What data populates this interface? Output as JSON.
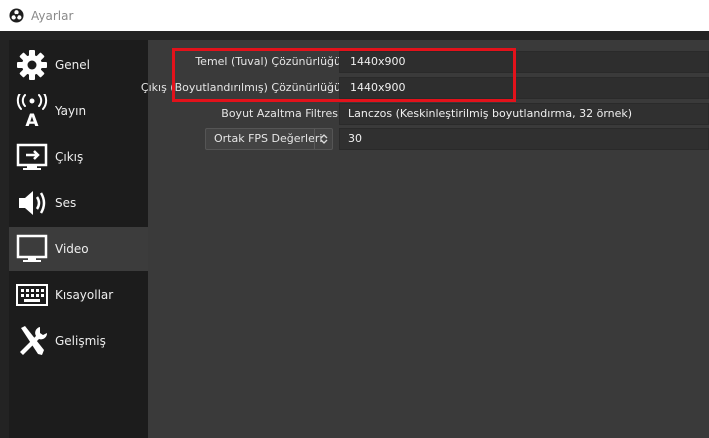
{
  "window": {
    "title": "Ayarlar"
  },
  "sidebar": {
    "items": [
      {
        "label": "Genel",
        "icon": "gear-icon",
        "active": false
      },
      {
        "label": "Yayın",
        "icon": "broadcast-icon",
        "active": false
      },
      {
        "label": "Çıkış",
        "icon": "output-icon",
        "active": false
      },
      {
        "label": "Ses",
        "icon": "speaker-icon",
        "active": false
      },
      {
        "label": "Video",
        "icon": "monitor-icon",
        "active": true
      },
      {
        "label": "Kısayollar",
        "icon": "keyboard-icon",
        "active": false
      },
      {
        "label": "Gelişmiş",
        "icon": "tools-icon",
        "active": false
      }
    ]
  },
  "video": {
    "base_resolution": {
      "label": "Temel (Tuval) Çözünürlüğü",
      "value": "1440x900"
    },
    "output_resolution": {
      "label": "Çıkış (Boyutlandırılmış) Çözünürlüğü",
      "value": "1440x900"
    },
    "downscale_filter": {
      "label": "Boyut Azaltma Filtresi",
      "value": "Lanczos (Keskinleştirilmiş boyutlandırma, 32 örnek)"
    },
    "fps": {
      "label": "Ortak FPS Değerleri",
      "value": "30"
    }
  },
  "colors": {
    "highlight": "#e3121b",
    "panel": "#3a3a3a",
    "sidebar": "#1c1c1c",
    "active_item": "#3c3c3c"
  }
}
